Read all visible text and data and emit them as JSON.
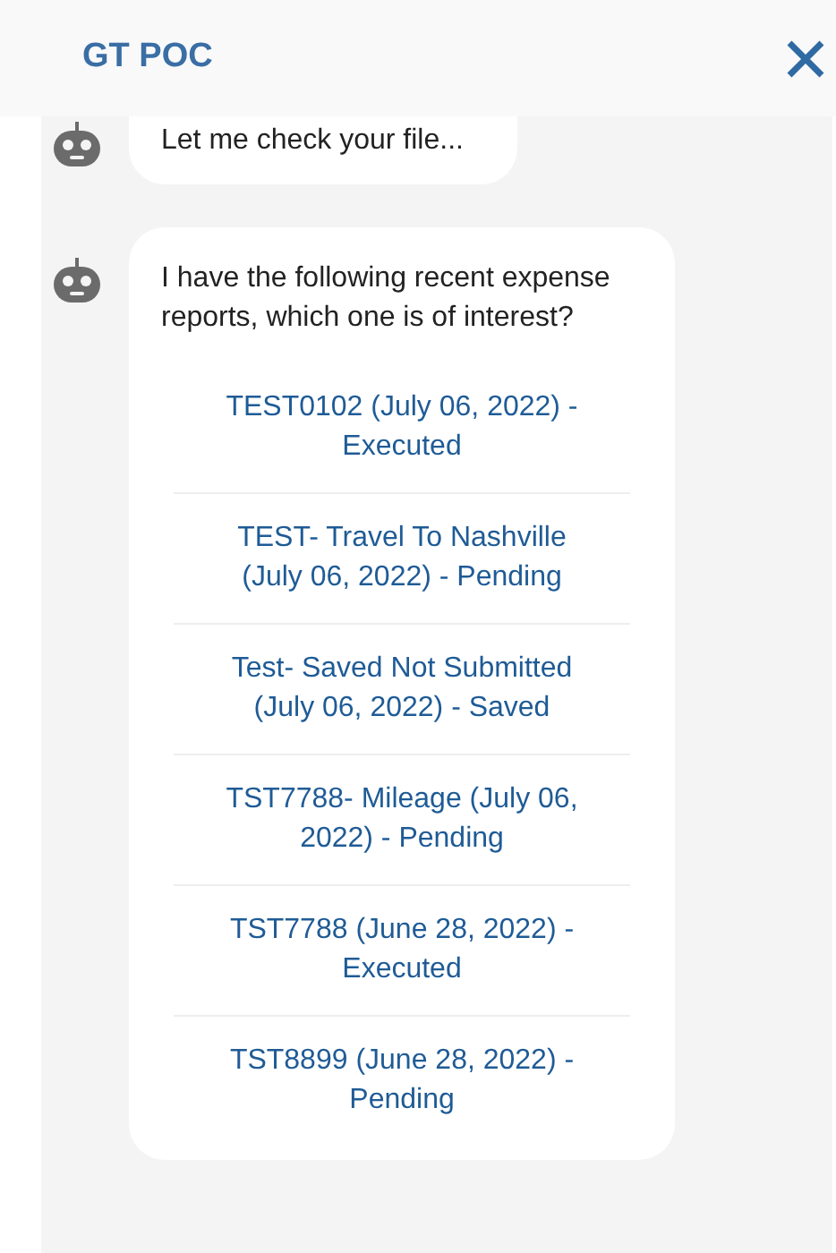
{
  "header": {
    "title": "GT POC"
  },
  "messages": [
    {
      "kind": "text",
      "text": "Let me check your file..."
    },
    {
      "kind": "options",
      "text": "I have the following recent expense reports, which one is of interest?",
      "options": [
        "TEST0102 (July 06, 2022) - Executed",
        "TEST- Travel To Nashville (July 06, 2022) - Pending",
        "Test- Saved Not Submitted (July 06, 2022) - Saved",
        "TST7788- Mileage (July 06, 2022) - Pending",
        "TST7788 (June 28, 2022) - Executed",
        "TST8899 (June 28, 2022) - Pending"
      ]
    }
  ]
}
